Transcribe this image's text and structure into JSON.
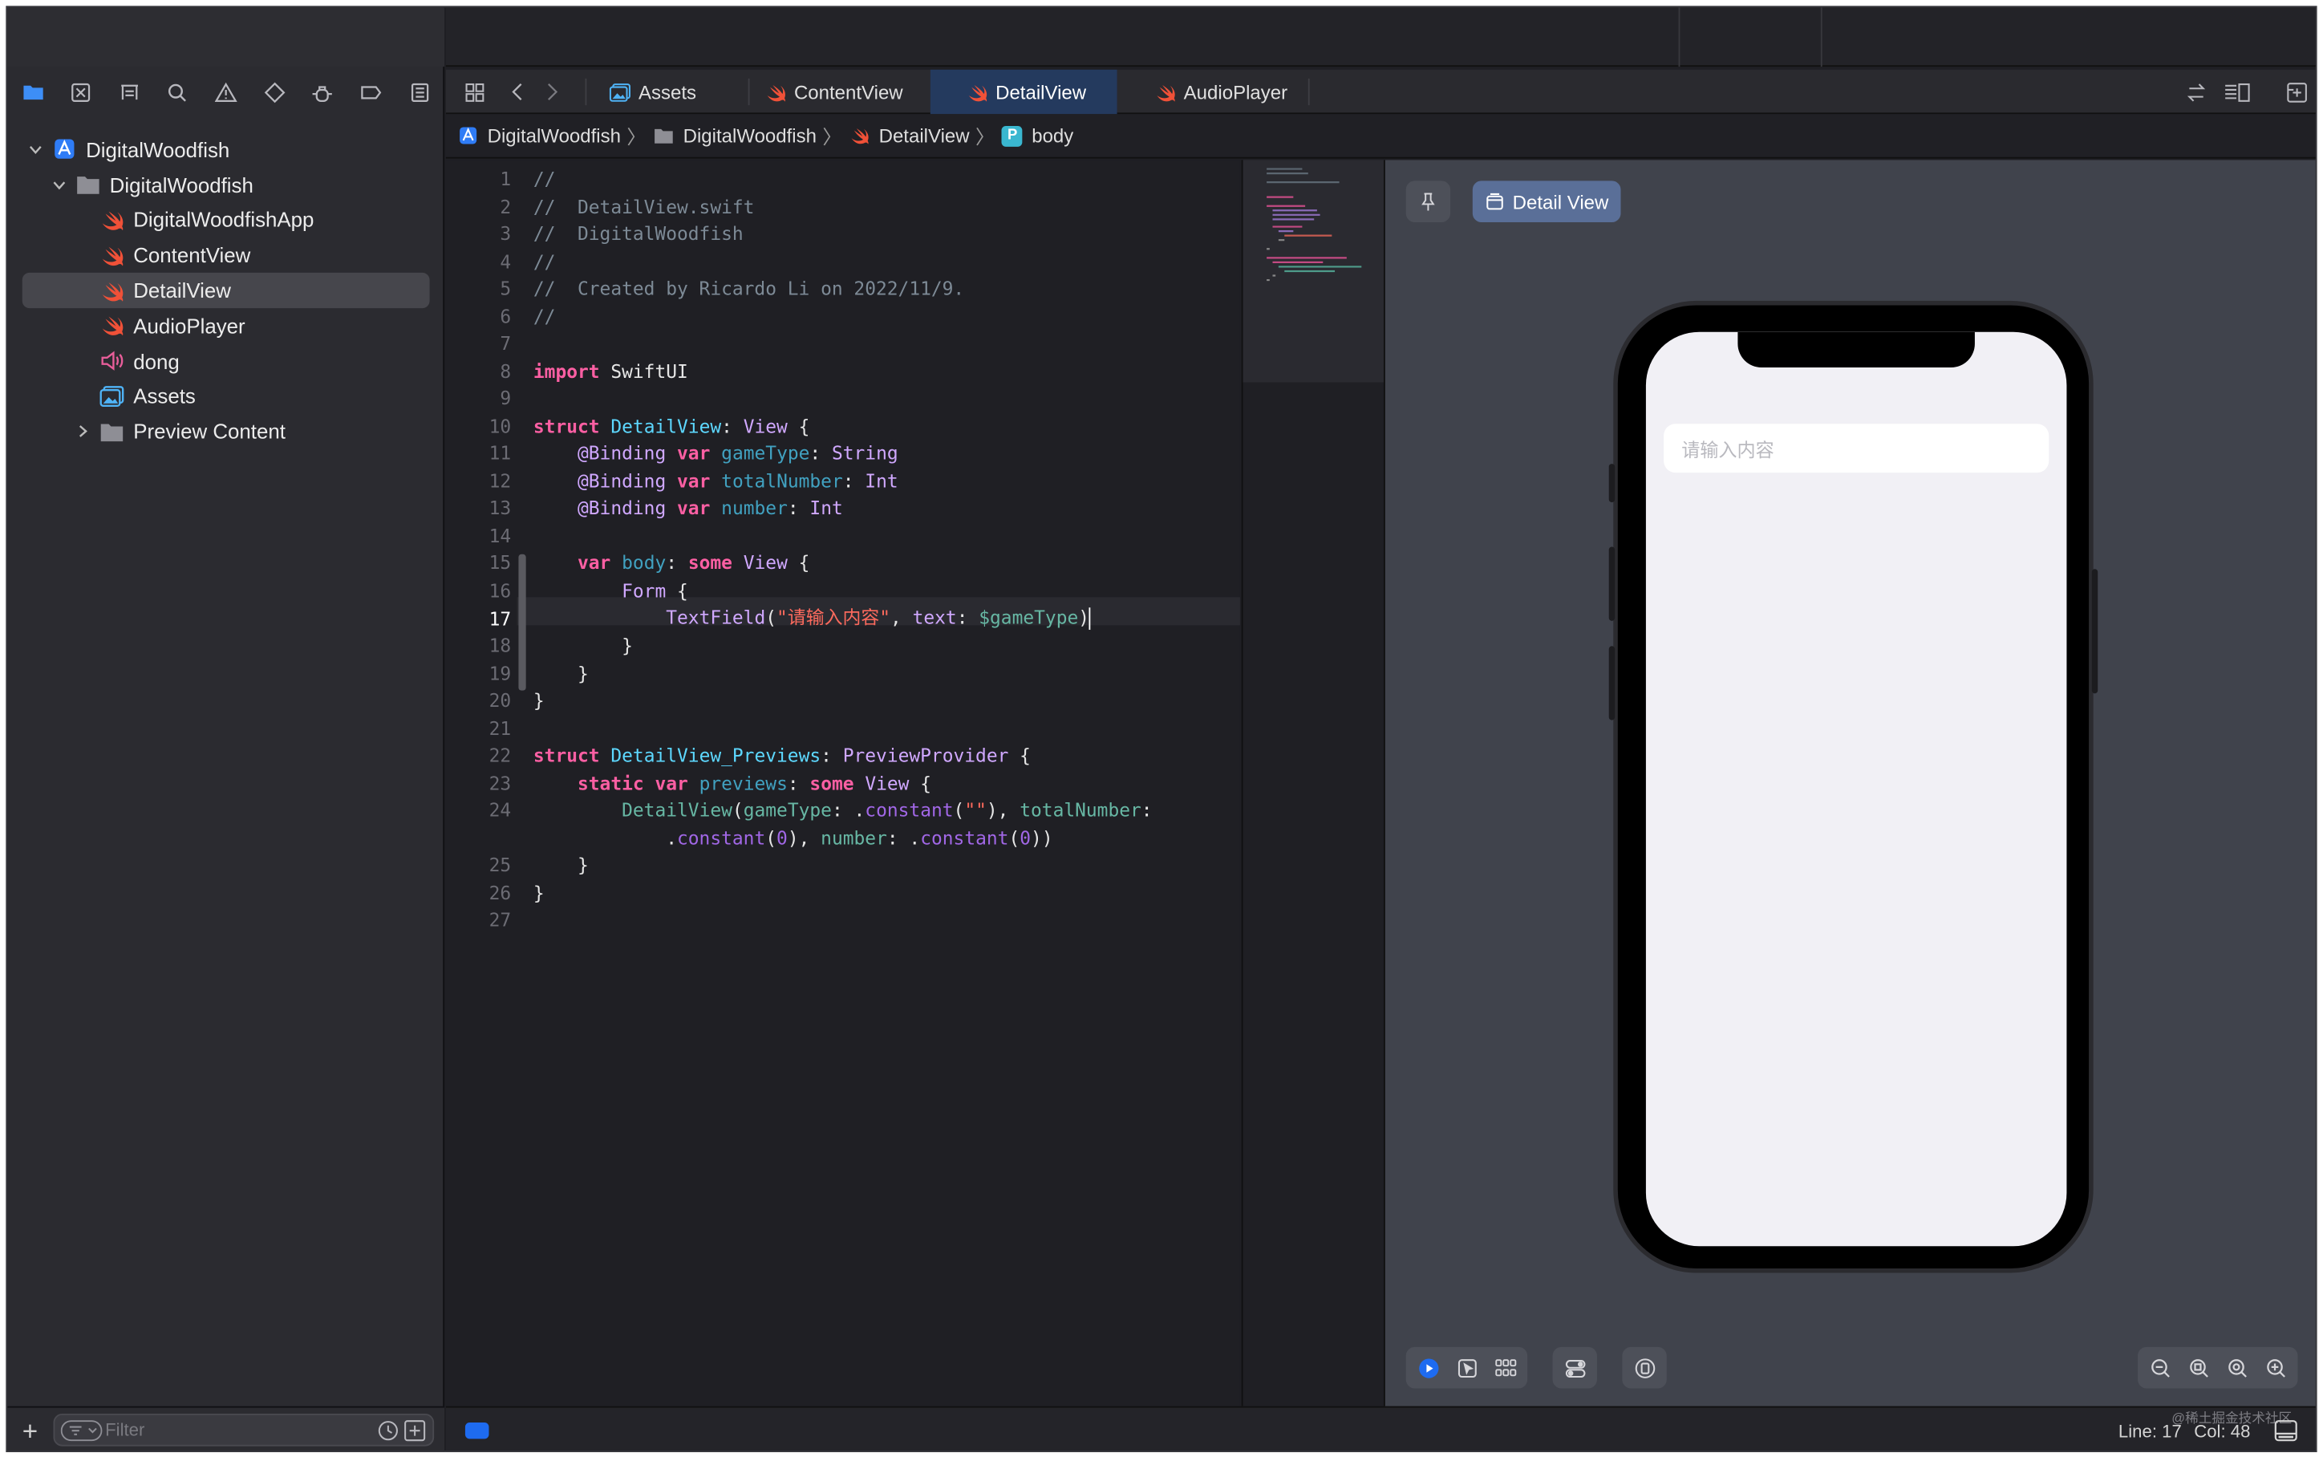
{
  "navigator": {
    "tabs": [
      "folder-icon",
      "source-control-icon",
      "symbol-icon",
      "search-icon",
      "warning-icon",
      "test-icon",
      "debug-icon",
      "breakpoint-icon",
      "report-icon"
    ],
    "tree": [
      {
        "label": "DigitalWoodfish",
        "kind": "project"
      },
      {
        "label": "DigitalWoodfish",
        "kind": "folder"
      },
      {
        "label": "DigitalWoodfishApp",
        "kind": "swift"
      },
      {
        "label": "ContentView",
        "kind": "swift"
      },
      {
        "label": "DetailView",
        "kind": "swift",
        "selected": true
      },
      {
        "label": "AudioPlayer",
        "kind": "swift"
      },
      {
        "label": "dong",
        "kind": "audio"
      },
      {
        "label": "Assets",
        "kind": "assets"
      },
      {
        "label": "Preview Content",
        "kind": "folder"
      }
    ],
    "filter_placeholder": "Filter"
  },
  "tabs": [
    {
      "label": "Assets",
      "icon": "assets-icon"
    },
    {
      "label": "ContentView",
      "icon": "swift-icon"
    },
    {
      "label": "DetailView",
      "icon": "swift-icon",
      "active": true
    },
    {
      "label": "AudioPlayer",
      "icon": "swift-icon"
    }
  ],
  "breadcrumb": [
    "DigitalWoodfish",
    "DigitalWoodfish",
    "DetailView",
    "body"
  ],
  "breadcrumb_badge": "P",
  "editor": {
    "current_line": 17,
    "line_numbers": [
      "1",
      "2",
      "3",
      "4",
      "5",
      "6",
      "7",
      "8",
      "9",
      "10",
      "11",
      "12",
      "13",
      "14",
      "15",
      "16",
      "17",
      "18",
      "19",
      "20",
      "21",
      "22",
      "23",
      "24",
      "",
      "25",
      "26",
      "27"
    ]
  },
  "preview": {
    "chip_label": "Detail View",
    "textfield_placeholder": "请输入内容"
  },
  "status": {
    "line_label": "Line: 17",
    "col_label": "Col: 48",
    "watermark": "@稀土掘金技术社区"
  },
  "colors": {
    "accent": "#1e6bf0",
    "active_tab": "#243a5e",
    "swift_orange": "#f05138",
    "keyword": "#fc5fa3",
    "type": "#5dd8ff"
  }
}
